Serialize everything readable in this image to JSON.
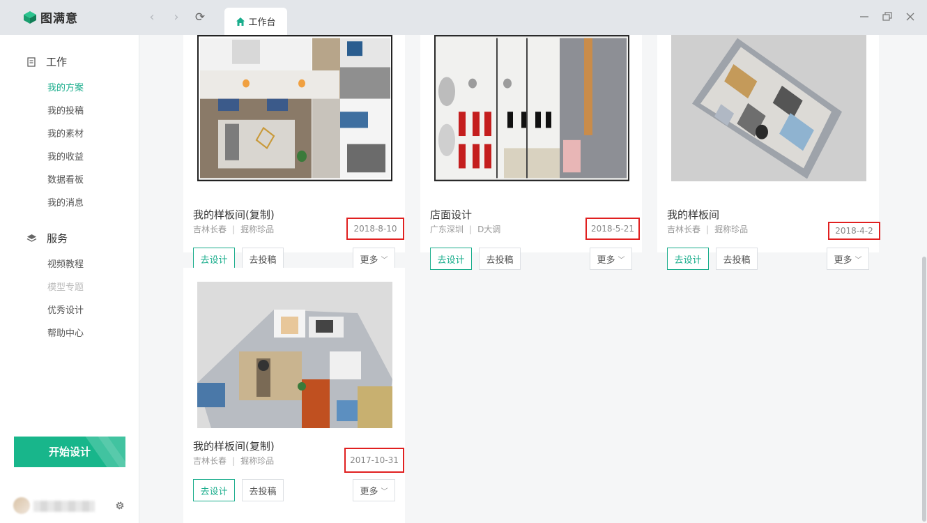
{
  "app": {
    "logo_text": "图满意"
  },
  "titlebar": {
    "tab_label": "工作台",
    "back_glyph": "‹",
    "forward_glyph": "›",
    "refresh_glyph": "⟳"
  },
  "sidebar": {
    "work_section": "工作",
    "work_items": [
      "我的方案",
      "我的投稿",
      "我的素材",
      "我的收益",
      "数据看板",
      "我的消息"
    ],
    "service_section": "服务",
    "service_items": [
      "视频教程",
      "模型专题",
      "优秀设计",
      "帮助中心"
    ],
    "start_button": "开始设计"
  },
  "actions": {
    "design": "去设计",
    "submit": "去投稿",
    "more": "更多"
  },
  "cards": [
    {
      "title": "我的样板间(复制)",
      "location": "吉林长春",
      "author": "掘称珍品",
      "date": "2018-8-10"
    },
    {
      "title": "店面设计",
      "location": "广东深圳",
      "author": "D大调",
      "date": "2018-5-21"
    },
    {
      "title": "我的样板间",
      "location": "吉林长春",
      "author": "掘称珍品",
      "date": "2018-4-2"
    },
    {
      "title": "我的样板间(复制)",
      "location": "吉林长春",
      "author": "掘称珍品",
      "date": "2017-10-31"
    }
  ],
  "colors": {
    "accent": "#1aad8c",
    "highlight_border": "#e02020",
    "titlebar": "#e3e6ea"
  }
}
